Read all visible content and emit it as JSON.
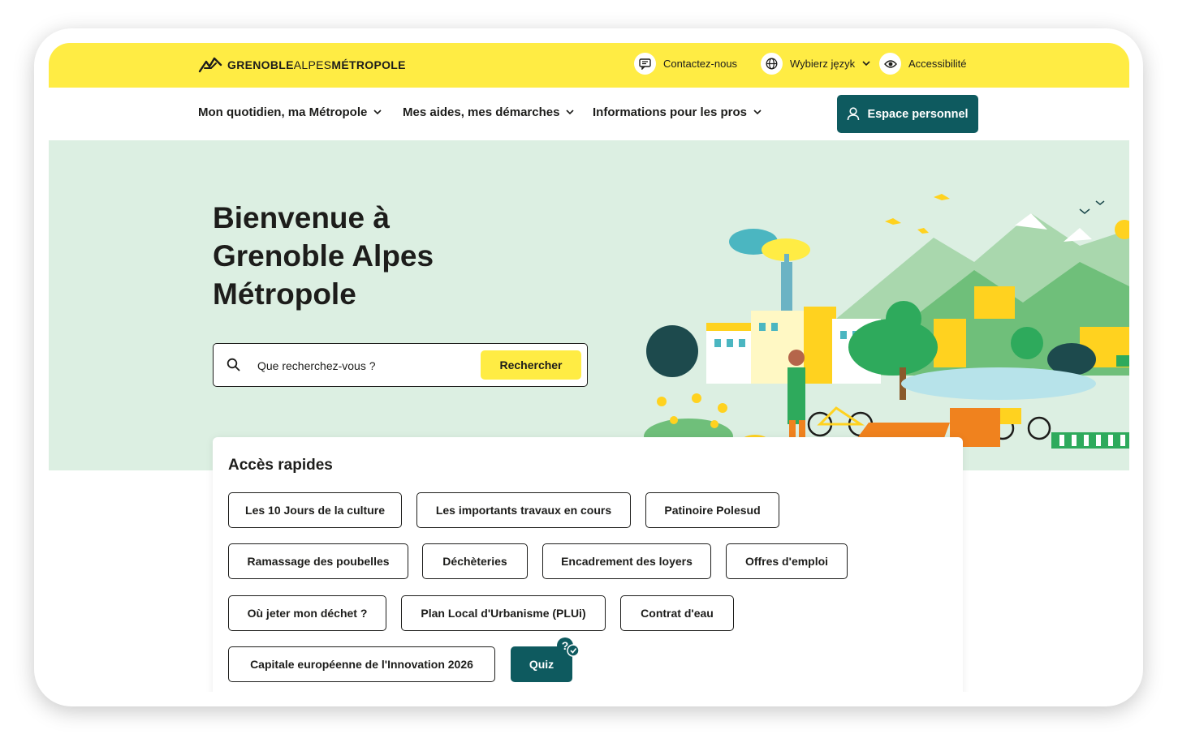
{
  "brand": {
    "logo_parts": [
      "GRENOBLE",
      "ALPES",
      "MÉTROPOLE"
    ],
    "yellow": "#ffec44",
    "teal": "#0e5a5f",
    "hero_bg": "#dcefe2"
  },
  "utility": {
    "contact_label": "Contactez-nous",
    "language_label": "Wybierz język",
    "accessibility_label": "Accessibilité"
  },
  "nav": {
    "items": [
      {
        "label": "Mon quotidien, ma Métropole"
      },
      {
        "label": "Mes aides, mes démarches"
      },
      {
        "label": "Informations pour les pros"
      }
    ],
    "account_label": "Espace personnel"
  },
  "hero": {
    "title": "Bienvenue à Grenoble Alpes Métropole",
    "search_placeholder": "Que recherchez-vous ?",
    "search_button": "Rechercher"
  },
  "quick_access": {
    "title": "Accès rapides",
    "links": [
      "Les 10 Jours de la culture",
      "Les importants travaux en cours",
      "Patinoire Polesud",
      "Ramassage des poubelles",
      "Déchèteries",
      "Encadrement des loyers",
      "Offres d'emploi",
      "Où jeter mon déchet ?",
      "Plan Local d'Urbanisme (PLUi)",
      "Contrat d'eau",
      "Capitale européenne de l'Innovation 2026"
    ],
    "quiz_label": "Quiz"
  }
}
